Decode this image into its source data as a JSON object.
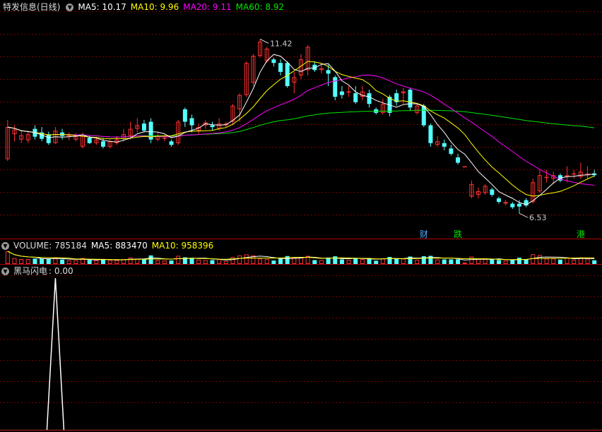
{
  "main_header": {
    "title": "特发信息(日线)",
    "ma5": "MA5: 10.17",
    "ma10": "MA10: 9.96",
    "ma20": "MA20: 9.11",
    "ma60": "MA60: 8.92"
  },
  "volume_header": {
    "title": "VOLUME: 785184",
    "ma5": "MA5: 883470",
    "ma10": "MA10: 958396"
  },
  "indicator_header": {
    "title": "黑马闪电",
    "value": ": 0.00"
  },
  "colors": {
    "up": "#ff3232",
    "down": "#54ffff",
    "ma5": "#ffffff",
    "ma10": "#ffff00",
    "ma20": "#ff00ff",
    "ma60": "#00e600",
    "grid": "#7a0000"
  },
  "annotations": {
    "high_label": "11.42",
    "low_label": "6.53"
  },
  "event_marks": [
    {
      "label": "财",
      "color": "#54a8ff"
    },
    {
      "label": "跌",
      "color": "#00e600"
    },
    {
      "label": "港",
      "color": "#00e600"
    }
  ],
  "chart_data": {
    "type": "candlestick",
    "price_range": [
      5.9,
      12.2
    ],
    "candles": [
      [
        8.05,
        8.95,
        8.0,
        9.15
      ],
      [
        8.75,
        8.88,
        8.55,
        9.0
      ],
      [
        8.6,
        8.72,
        8.5,
        8.85
      ],
      [
        8.58,
        8.75,
        8.5,
        8.85
      ],
      [
        8.9,
        8.68,
        8.6,
        9.0
      ],
      [
        8.8,
        8.62,
        8.55,
        8.95
      ],
      [
        8.75,
        8.5,
        8.45,
        8.82
      ],
      [
        8.5,
        8.85,
        8.48,
        8.95
      ],
      [
        8.8,
        8.7,
        8.6,
        8.9
      ],
      [
        8.7,
        8.72,
        8.58,
        8.8
      ],
      [
        8.6,
        8.7,
        8.55,
        8.78
      ],
      [
        8.4,
        8.7,
        8.35,
        8.8
      ],
      [
        8.65,
        8.5,
        8.48,
        8.72
      ],
      [
        8.5,
        8.6,
        8.45,
        8.68
      ],
      [
        8.55,
        8.4,
        8.35,
        8.65
      ],
      [
        8.4,
        8.55,
        8.35,
        8.6
      ],
      [
        8.5,
        8.6,
        8.45,
        8.7
      ],
      [
        8.62,
        8.75,
        8.55,
        8.9
      ],
      [
        8.7,
        8.9,
        8.6,
        9.1
      ],
      [
        8.9,
        9.0,
        8.8,
        9.2
      ],
      [
        9.05,
        8.85,
        8.8,
        9.15
      ],
      [
        9.1,
        8.6,
        8.5,
        9.2
      ],
      [
        8.6,
        8.7,
        8.55,
        8.8
      ],
      [
        8.65,
        8.65,
        8.55,
        8.75
      ],
      [
        8.55,
        8.45,
        8.4,
        8.6
      ],
      [
        8.5,
        9.1,
        8.45,
        9.15
      ],
      [
        9.45,
        9.1,
        8.95,
        9.5
      ],
      [
        9.2,
        9.0,
        8.8,
        9.3
      ],
      [
        8.85,
        8.95,
        8.75,
        9.05
      ],
      [
        9.0,
        9.08,
        8.9,
        9.15
      ],
      [
        9.0,
        8.95,
        8.85,
        9.1
      ],
      [
        8.9,
        9.05,
        8.85,
        9.2
      ],
      [
        9.0,
        9.05,
        8.95,
        9.1
      ],
      [
        9.1,
        9.55,
        9.0,
        9.6
      ],
      [
        9.45,
        9.85,
        9.1,
        9.9
      ],
      [
        9.85,
        10.75,
        9.8,
        10.8
      ],
      [
        10.2,
        10.95,
        10.1,
        11.0
      ],
      [
        10.95,
        11.35,
        10.9,
        11.42
      ],
      [
        10.8,
        11.15,
        10.75,
        11.2
      ],
      [
        10.85,
        10.75,
        10.65,
        10.9
      ],
      [
        10.75,
        10.5,
        10.4,
        10.85
      ],
      [
        10.75,
        10.1,
        10.05,
        10.8
      ],
      [
        10.2,
        10.35,
        9.9,
        10.5
      ],
      [
        10.4,
        10.85,
        10.3,
        11.0
      ],
      [
        10.55,
        11.2,
        10.4,
        11.25
      ],
      [
        10.7,
        10.55,
        10.5,
        10.8
      ],
      [
        10.55,
        10.6,
        10.45,
        10.75
      ],
      [
        10.55,
        10.45,
        10.1,
        10.7
      ],
      [
        10.35,
        9.8,
        9.7,
        10.4
      ],
      [
        9.95,
        9.85,
        9.75,
        10.1
      ],
      [
        9.95,
        9.95,
        9.8,
        10.1
      ],
      [
        9.9,
        9.65,
        9.6,
        10.1
      ],
      [
        9.8,
        9.95,
        9.7,
        10.1
      ],
      [
        9.9,
        9.6,
        9.5,
        10.0
      ],
      [
        9.45,
        9.35,
        9.3,
        9.5
      ],
      [
        9.35,
        9.6,
        9.3,
        9.75
      ],
      [
        9.8,
        9.35,
        9.25,
        9.85
      ],
      [
        9.9,
        9.65,
        9.55,
        10.0
      ],
      [
        9.9,
        9.95,
        9.6,
        10.05
      ],
      [
        10.0,
        9.5,
        9.4,
        10.05
      ],
      [
        9.35,
        9.55,
        9.3,
        9.6
      ],
      [
        9.55,
        9.0,
        8.95,
        9.6
      ],
      [
        9.0,
        8.5,
        8.4,
        9.05
      ],
      [
        8.45,
        8.55,
        8.4,
        8.7
      ],
      [
        8.5,
        8.4,
        8.3,
        8.6
      ],
      [
        8.35,
        8.2,
        8.15,
        8.45
      ],
      [
        8.1,
        7.95,
        7.9,
        8.2
      ],
      [
        7.85,
        7.85,
        7.85,
        7.85
      ],
      [
        7.0,
        7.35,
        6.95,
        7.45
      ],
      [
        7.05,
        7.15,
        6.95,
        7.25
      ],
      [
        7.1,
        7.3,
        7.05,
        7.35
      ],
      [
        7.2,
        7.05,
        7.0,
        7.25
      ],
      [
        6.95,
        6.85,
        6.8,
        7.0
      ],
      [
        6.8,
        6.85,
        6.75,
        6.9
      ],
      [
        6.8,
        6.7,
        6.65,
        6.85
      ],
      [
        6.8,
        6.72,
        6.53,
        6.9
      ],
      [
        6.9,
        6.75,
        6.7,
        6.95
      ],
      [
        6.85,
        7.4,
        6.8,
        7.5
      ],
      [
        7.15,
        7.6,
        7.1,
        7.75
      ],
      [
        7.55,
        7.55,
        7.4,
        7.75
      ],
      [
        7.5,
        7.6,
        7.35,
        7.7
      ],
      [
        7.6,
        7.45,
        7.4,
        7.65
      ],
      [
        7.55,
        7.6,
        7.4,
        7.85
      ],
      [
        7.65,
        7.65,
        7.5,
        7.75
      ],
      [
        7.55,
        7.7,
        7.5,
        7.95
      ],
      [
        7.6,
        7.65,
        7.5,
        7.85
      ],
      [
        7.65,
        7.6,
        7.55,
        7.75
      ]
    ],
    "indicator": {
      "name": "黑马闪电",
      "spike_bar_index": 7,
      "spike_value": 1.0
    }
  }
}
